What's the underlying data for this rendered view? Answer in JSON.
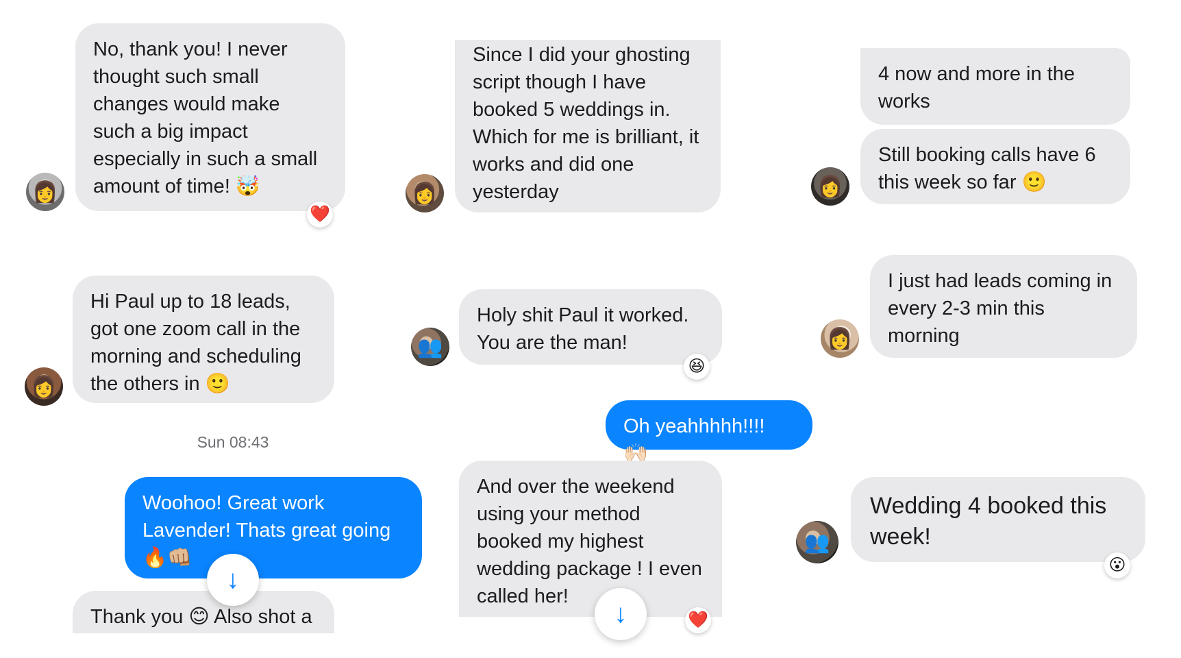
{
  "messages": [
    {
      "text": "No, thank you! I never\nthought such small\nchanges would make\nsuch a big impact\nespecially in such a small\namount of time! 🤯",
      "reaction": "❤️"
    },
    {
      "text": "Since I did your ghosting\nscript though I have\nbooked 5 weddings in.\nWhich for me is brilliant, it\nworks and did one\nyesterday"
    },
    {
      "text": "4 now and more in the\nworks"
    },
    {
      "text": "Still booking calls have 6\nthis week so far 🙂"
    },
    {
      "text": "Hi Paul up to 18 leads,\ngot one zoom call in the\nmorning and scheduling\nthe others in 🙂"
    },
    {
      "text": "Holy shit Paul it worked.\nYou are the man!",
      "reaction": "😆"
    },
    {
      "text": "I just had leads coming in\nevery 2-3 min this\nmorning"
    },
    {
      "text": "Oh yeahhhhh!!!! 🙌🏻"
    },
    {
      "text": "Woohoo! Great work\nLavender! Thats great going\n🔥👊🏼"
    },
    {
      "text": "Thank you 😊 Also shot a"
    },
    {
      "text": "And over the weekend\nusing your method\nbooked my highest\nwedding package ! I even\ncalled her!",
      "reaction": "❤️"
    },
    {
      "text": "Wedding 4 booked this\nweek!",
      "reaction": "😮"
    }
  ],
  "timestamp": "Sun 08:43",
  "icons": {
    "avatar": "person-icon",
    "scroll_down": "arrow-down-icon",
    "scroll_glyph": "↓"
  },
  "colors": {
    "incoming_bubble": "#e9e9eb",
    "outgoing_bubble": "#0a84ff",
    "scroll_arrow": "#0a84ff"
  }
}
